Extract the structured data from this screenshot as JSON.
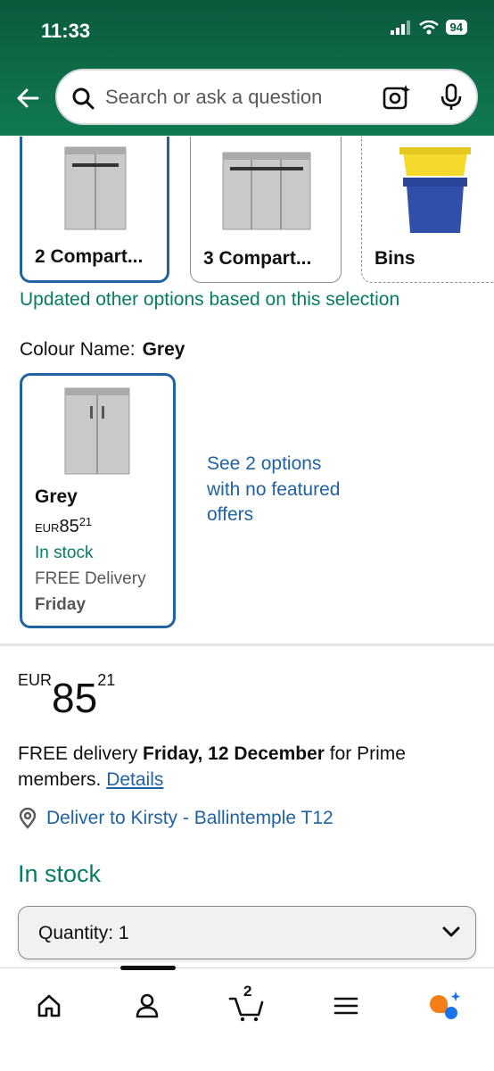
{
  "status_bar": {
    "time": "11:33",
    "battery": "94"
  },
  "search": {
    "placeholder": "Search or ask a question"
  },
  "options": [
    {
      "label": "2 Compart..."
    },
    {
      "label": "3 Compart..."
    },
    {
      "label": "Bins"
    }
  ],
  "updated_note": "Updated other options based on this selection",
  "colour": {
    "label": "Colour Name:",
    "value": "Grey"
  },
  "swatch": {
    "name": "Grey",
    "currency": "EUR",
    "whole": "85",
    "cents": "21",
    "stock": "In stock",
    "delivery": "FREE Delivery",
    "day": "Friday"
  },
  "see_options": "See 2 options with no featured offers",
  "price": {
    "currency": "EUR",
    "whole": "85",
    "cents": "21"
  },
  "delivery": {
    "prefix": "FREE delivery ",
    "date": "Friday, 12 December",
    "suffix": " for Prime members. ",
    "details_link": "Details"
  },
  "deliver_to": "Deliver to Kirsty - Ballintemple T12",
  "stock_status": "In stock",
  "quantity": {
    "label": "Quantity:",
    "value": "1"
  },
  "cart_count": "2",
  "colors": {
    "header_green": "#0a5a3c",
    "link_blue": "#2162a1",
    "stock_green": "#067d62",
    "selected_border": "#2162a1"
  },
  "icons": [
    "back-arrow-icon",
    "search-icon",
    "camera-icon",
    "microphone-icon",
    "location-pin-icon",
    "chevron-down-icon",
    "home-icon",
    "account-icon",
    "cart-icon",
    "menu-icon",
    "assistant-icon"
  ]
}
